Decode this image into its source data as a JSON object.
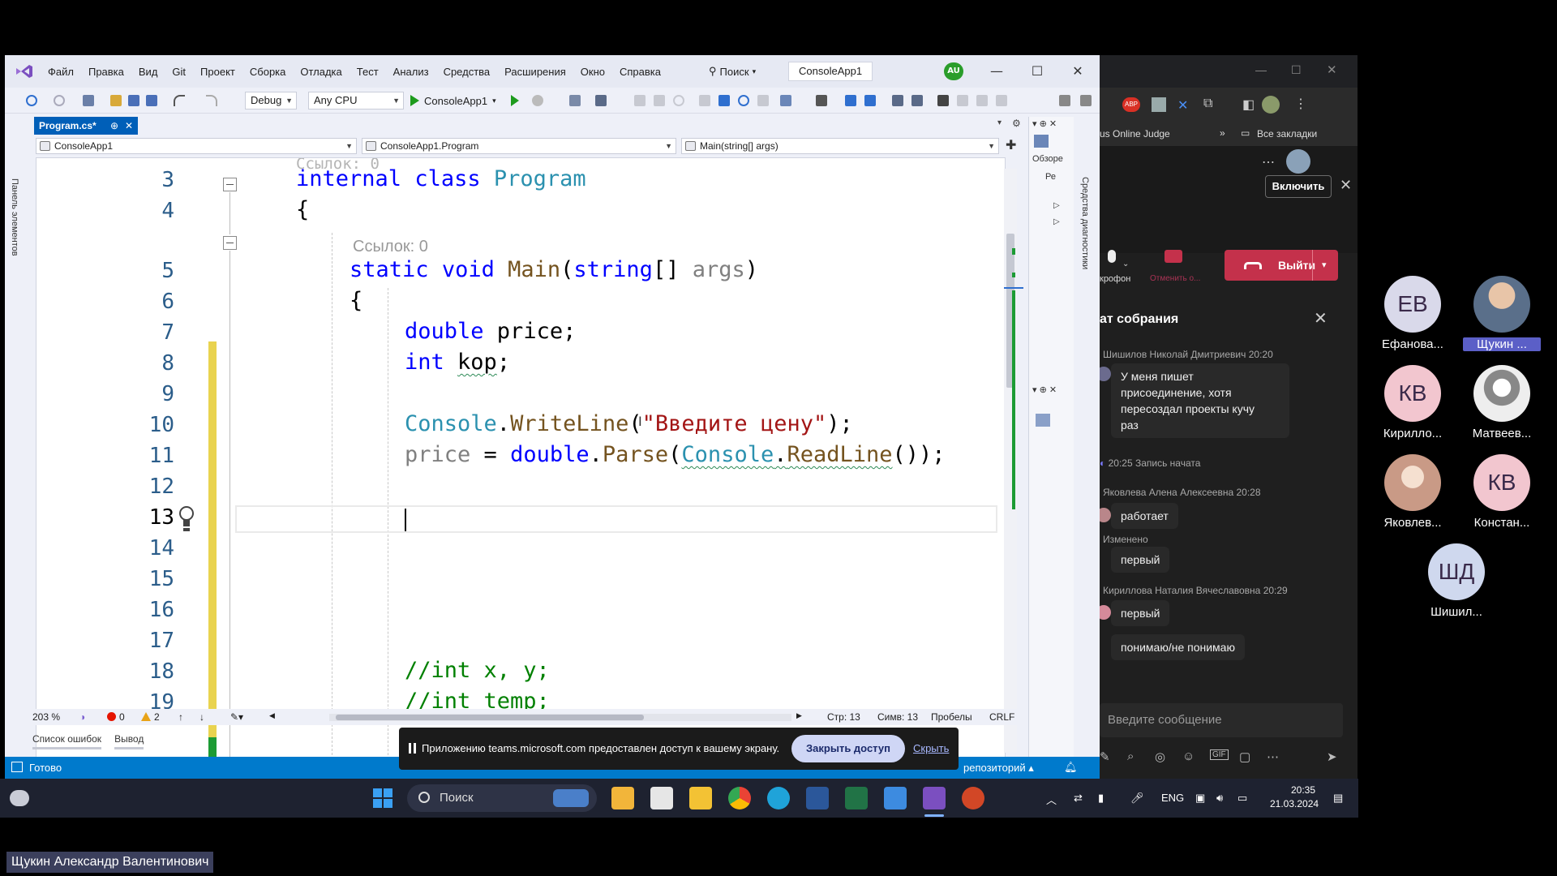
{
  "vs": {
    "menu": [
      "Файл",
      "Правка",
      "Вид",
      "Git",
      "Проект",
      "Сборка",
      "Отладка",
      "Тест",
      "Анализ",
      "Средства",
      "Расширения",
      "Окно",
      "Справка"
    ],
    "search_label": "Поиск",
    "solution_name": "ConsoleApp1",
    "user_initials": "AU",
    "toolbar": {
      "config": "Debug",
      "platform": "Any CPU",
      "run_label": "ConsoleApp1"
    },
    "side_panel_label": "Панель элементов",
    "tab": {
      "label": "Program.cs*",
      "pin": "⊕",
      "close": "✕"
    },
    "nav": {
      "project": "ConsoleApp1",
      "class": "ConsoleApp1.Program",
      "member": "Main(string[] args)"
    },
    "right_panel": {
      "overview": "Обзоре",
      "ref": "Ре",
      "diag_label": "Средства диагностики"
    },
    "editor": {
      "ghost_top": "Ссылок: 0",
      "refs_hint": "Ссылок: 0",
      "line_numbers": [
        "3",
        "4",
        "5",
        "6",
        "7",
        "8",
        "9",
        "10",
        "11",
        "12",
        "13",
        "14",
        "15",
        "16",
        "17",
        "18",
        "19"
      ],
      "code": {
        "l3_kw1": "internal",
        "l3_kw2": "class",
        "l3_type": "Program",
        "l4": "{",
        "l5_kw1": "static",
        "l5_kw2": "void",
        "l5_meth": "Main",
        "l5_open": "(",
        "l5_kw3": "string",
        "l5_arr": "[] ",
        "l5_par": "args",
        "l5_close": ")",
        "l6": "{",
        "l7_kw": "double",
        "l7_rest": " price;",
        "l8_kw": "int",
        "l8_var": "kop",
        "l8_end": ";",
        "l10_type": "Console",
        "l10_dot": ".",
        "l10_meth": "WriteLine",
        "l10_open": "(",
        "l10_str": "\"Введите цену\"",
        "l10_end": ");",
        "l11_var": "price",
        "l11_eq": " = ",
        "l11_kw": "double",
        "l11_dot": ".",
        "l11_meth": "Parse",
        "l11_open": "(",
        "l11_type": "Console",
        "l11_dot2": ".",
        "l11_meth2": "ReadLine",
        "l11_end": "());",
        "l17": "//int x, y;",
        "l18": "//int temp;"
      }
    },
    "bottom": {
      "zoom": "203 %",
      "errors": "0",
      "warnings": "2",
      "line": "Стр: 13",
      "col": "Симв: 13",
      "spaces": "Пробелы",
      "eol": "CRLF"
    },
    "output_tabs": [
      "Список ошибок",
      "Вывод"
    ],
    "status": {
      "ready": "Готово",
      "repo": "репозиторий"
    },
    "share_bar": {
      "message": "Приложению teams.microsoft.com предоставлен доступ к вашему экрану.",
      "stop": "Закрыть доступ",
      "hide": "Скрыть"
    }
  },
  "taskbar": {
    "search": "Поиск",
    "lang": "ENG",
    "time": "20:35",
    "date": "21.03.2024"
  },
  "teams": {
    "bookmarks": {
      "judge": "us Online Judge",
      "all": "Все закладки"
    },
    "enable": "Включить",
    "mic_label": "крофон",
    "stop_label": "Отменить о...",
    "leave": "Выйти",
    "chat_title": "ат собрания",
    "messages": [
      {
        "author": "Шишилов Николай Дмитриевич",
        "time": "20:20",
        "text_lines": [
          "У меня пишет",
          "присоединение, хотя",
          "пересоздал проекты кучу",
          "раз"
        ]
      },
      {
        "system": "20:25   Запись начата"
      },
      {
        "author": "Яковлева Алена Алексеевна",
        "time": "20:28",
        "text": "работает"
      },
      {
        "edited": "Изменено",
        "text": "первый"
      },
      {
        "author": "Кириллова Наталия Вячеславовна",
        "time": "20:29",
        "text": "первый"
      },
      {
        "text": "понимаю/не понимаю"
      }
    ],
    "compose_placeholder": "Введите сообщение"
  },
  "participants": [
    {
      "initials": "ЕВ",
      "name": "Ефанова...",
      "color": "#d9d9ea"
    },
    {
      "initials": "",
      "name": "Щукин ...",
      "color": "#8aa1b8",
      "highlight": true
    },
    {
      "initials": "КВ",
      "name": "Кирилло...",
      "color": "#f2c6cf"
    },
    {
      "initials": "",
      "name": "Матвеев...",
      "color": "#e6e6e6"
    },
    {
      "initials": "",
      "name": "Яковлев...",
      "color": "#e9c9b7"
    },
    {
      "initials": "КВ",
      "name": "Констан...",
      "color": "#f2c6cf"
    },
    {
      "initials": "ШД",
      "name": "Шишил...",
      "color": "#cfd8ee"
    }
  ],
  "presenter": "Щукин Александр Валентинович"
}
